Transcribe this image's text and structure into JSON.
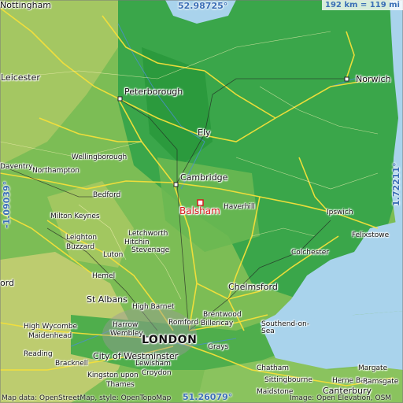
{
  "coords": {
    "top_lat": "52.98725°",
    "bottom_lat": "51.26079°",
    "left_lon": "-1.09039°",
    "right_lon": "1.72211°"
  },
  "scale": "192 km = 119 mi",
  "focus_place": "Balsham",
  "places": {
    "nottingham": "Nottingham",
    "leicester": "Leicester",
    "peterborough": "Peterborough",
    "norwich": "Norwich",
    "ely": "Ely",
    "cambridge": "Cambridge",
    "haverhill": "Haverhill",
    "ipswich": "Ipswich",
    "felixstowe": "Felixstowe",
    "colchester": "Colchester",
    "chelmsford": "Chelmsford",
    "southend": "Southend-on-Sea",
    "wellingborough": "Wellingborough",
    "daventry": "Daventry",
    "northampton": "Northampton",
    "bedford": "Bedford",
    "milton_keynes": "Milton Keynes",
    "leighton": "Leighton",
    "buzzard": "Buzzard",
    "letchworth": "Letchworth",
    "hitchin": "Hitchin",
    "stevenage": "Stevenage",
    "luton": "Luton",
    "hemel": "Hemel",
    "st_albans": "St Albans",
    "high_barnet": "High Barnet",
    "brentwood": "Brentwood",
    "romford": "Romford",
    "billericay": "Billericay",
    "high_wycombe": "High Wycombe",
    "maidenhead": "Maidenhead",
    "harrow": "Harrow",
    "wembley": "Wembley",
    "london": "LONDON",
    "city_of_westminster": "City of Westminster",
    "grays": "Grays",
    "reading": "Reading",
    "bracknell": "Bracknell",
    "lewisham": "Lewisham",
    "kingston": "Kingston upon",
    "thames": "Thames",
    "croydon": "Croydon",
    "chatham": "Chatham",
    "sittingbourne": "Sittingbourne",
    "herne_bay": "Herne Bay",
    "margate": "Margate",
    "ramsgate": "Ramsgate",
    "maidstone": "Maidstone",
    "canterbury": "Canterbury",
    "ord": "ord"
  },
  "credits": {
    "left": "Map data: OpenStreetMap, style: OpenTopoMap",
    "right": "Image: Open Elevation, OSM"
  },
  "colors": {
    "sea": "#a9d3ec",
    "lowland": "#2fa046",
    "midland": "#86c25c",
    "upland": "#d8d07a",
    "roads": "#f5e03a",
    "rivers": "#4a8fd0",
    "focus": "#d7191c"
  }
}
